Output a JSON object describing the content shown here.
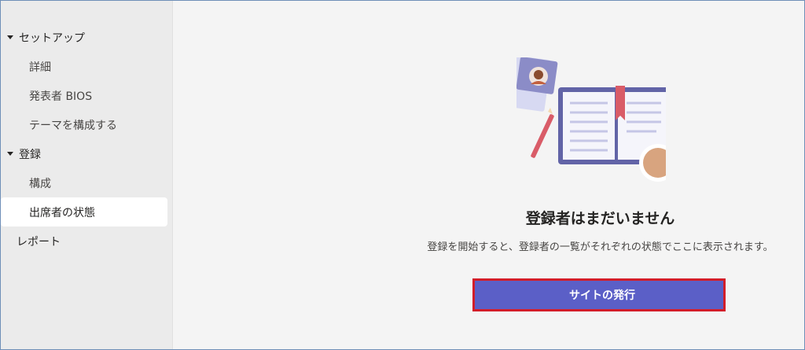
{
  "sidebar": {
    "groups": [
      {
        "label": "セットアップ",
        "items": [
          {
            "label": "詳細"
          },
          {
            "label": "発表者 BIOS"
          },
          {
            "label": "テーマを構成する"
          }
        ]
      },
      {
        "label": "登録",
        "items": [
          {
            "label": "構成"
          },
          {
            "label": "出席者の状態"
          }
        ]
      }
    ],
    "report_label": "レポート"
  },
  "main": {
    "empty_title": "登録者はまだいません",
    "empty_description": "登録を開始すると、登録者の一覧がそれぞれの状態でここに表示されます。",
    "publish_button": "サイトの発行"
  },
  "colors": {
    "accent": "#5b5fc7",
    "highlight_border": "#d21d2a"
  }
}
